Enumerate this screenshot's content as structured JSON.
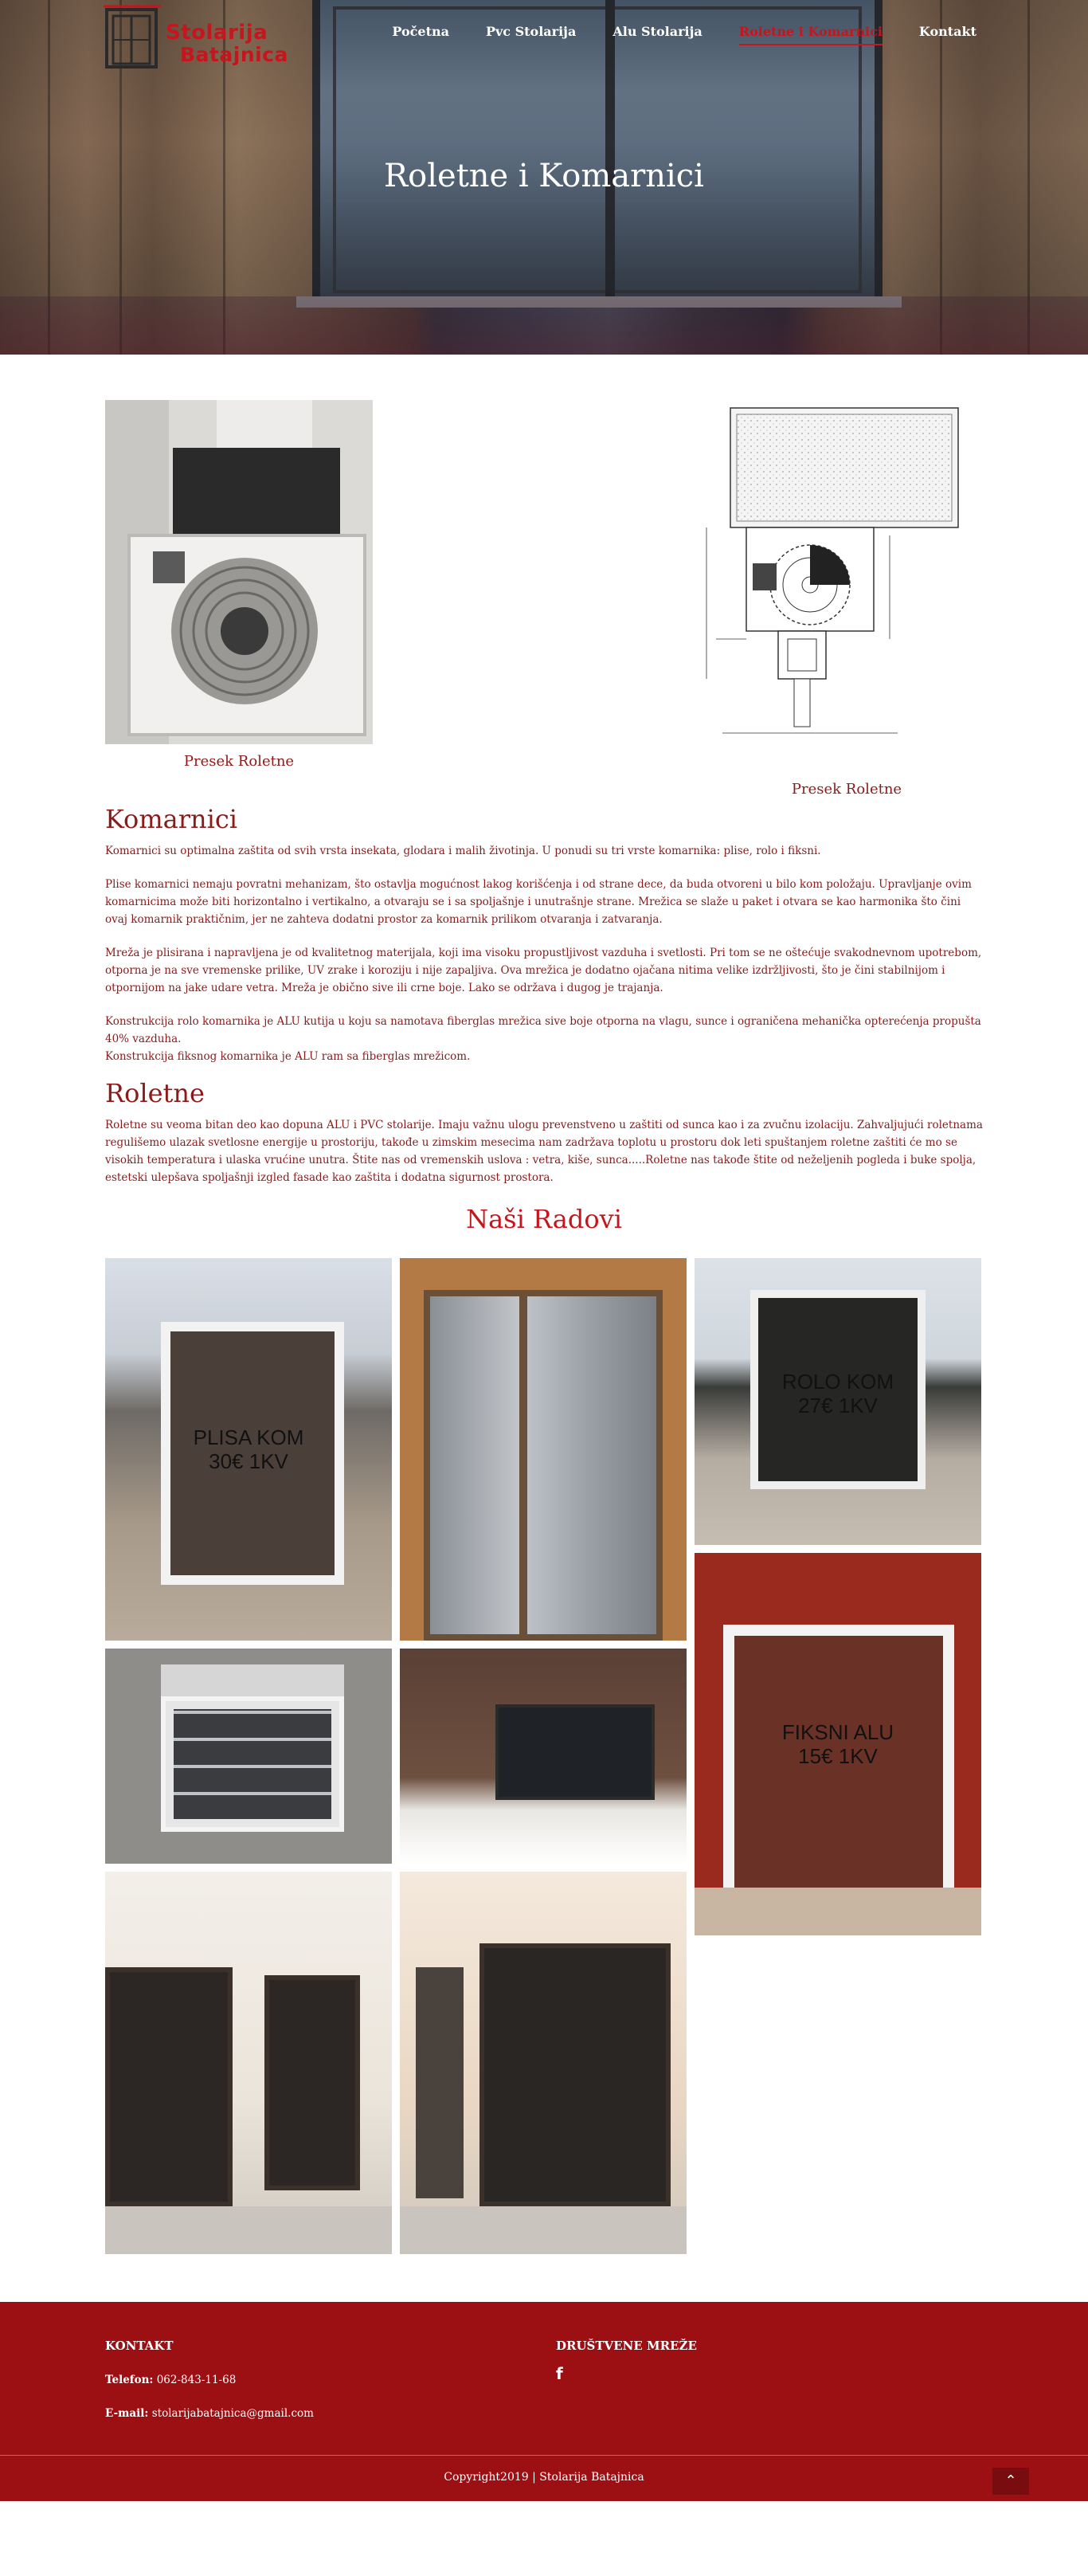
{
  "brand": {
    "logo_line1": "Stolarija",
    "logo_line2": "Batajnica",
    "accent": "#c4161c",
    "footer_bg": "#9c1014"
  },
  "nav": {
    "items": [
      {
        "label": "Početna",
        "active": false
      },
      {
        "label": "Pvc Stolarija",
        "active": false
      },
      {
        "label": "Alu Stolarija",
        "active": false
      },
      {
        "label": "Roletne i Komarnici",
        "active": true
      },
      {
        "label": "Kontakt",
        "active": false
      }
    ]
  },
  "hero": {
    "title": "Roletne i Komarnici"
  },
  "figures": {
    "left_caption": "Presek Roletne",
    "right_caption": "Presek Roletne"
  },
  "komarnici": {
    "heading": "Komarnici",
    "p1": "Komarnici su optimalna zaštita od svih vrsta insekata, glodara i malih životinja. U ponudi su tri vrste komarnika: plise, rolo i fiksni.",
    "p2": "Plise komarnici nemaju povratni mehanizam, što ostavlja mogućnost lakog korišćenja i od strane dece, da buda otvoreni u bilo kom položaju. Upravljanje ovim komarnicima može biti horizontalno i vertikalno, a otvaraju se i sa spoljašnje i unutrašnje strane. Mrežica se slaže u paket i otvara se kao harmonika što čini ovaj komarnik praktičnim, jer ne zahteva dodatni prostor za komarnik prilikom otvaranja i zatvaranja.",
    "p3": "Mreža je plisirana i napravljena je od kvalitetnog materijala, koji ima visoku propustljivost vazduha i svetlosti. Pri tom se ne oštećuje svakodnevnom upotrebom, otporna je na sve vremenske prilike, UV zrake i koroziju i nije zapaljiva. Ova mrežica je dodatno ojačana nitima velike izdržljivosti, što je čini stabilnijom i otpornijom na jake udare vetra. Mreža je obično sive ili crne boje. Lako se održava i dugog je trajanja.",
    "p4a": "Konstrukcija rolo komarnika je ALU kutija u koju sa namotava fiberglas mrežica sive boje otporna na vlagu, sunce i ograničena mehanička opterećenja propušta 40% vazduha.",
    "p4b": "Konstrukcija fiksnog komarnika je ALU ram sa fiberglas mrežicom."
  },
  "roletne": {
    "heading": "Roletne",
    "p1": "Roletne su veoma bitan deo kao dopuna ALU i PVC stolarije. Imaju važnu ulogu prevenstveno u zaštiti od sunca kao i za zvučnu izolaciju. Zahvaljujući roletnama regulišemo ulazak svetlosne energije u prostoriju, takođe u zimskim mesecima nam zadržava toplotu u prostoru dok leti spuštanjem roletne zaštiti će mo se visokih temperatura i ulaska vrućine unutra. Štite nas od vremenskih uslova : vetra, kiše, sunca.....Roletne nas takođe štite od neželjenih pogleda i buke spolja, estetski ulepšava spoljašnji izgled fasade kao zaštita i dodatna sigurnost prostora."
  },
  "works": {
    "title": "Naši Radovi",
    "labels": {
      "plise": [
        "PLISA KOM",
        "30€ 1KV"
      ],
      "rolo": [
        "ROLO KOM",
        "27€ 1KV"
      ],
      "fiksni": [
        "FIKSNI ALU",
        "15€ 1KV"
      ]
    }
  },
  "footer": {
    "contact_heading": "KONTAKT",
    "phone_label": "Telefon:",
    "phone_value": "062-843-11-68",
    "email_label": "E-mail:",
    "email_value": "stolarijabatajnica@gmail.com",
    "social_heading": "DRUŠTVENE MREŽE",
    "social_icon": "facebook-icon",
    "copyright": "Copyright2019 | Stolarija Batajnica"
  }
}
